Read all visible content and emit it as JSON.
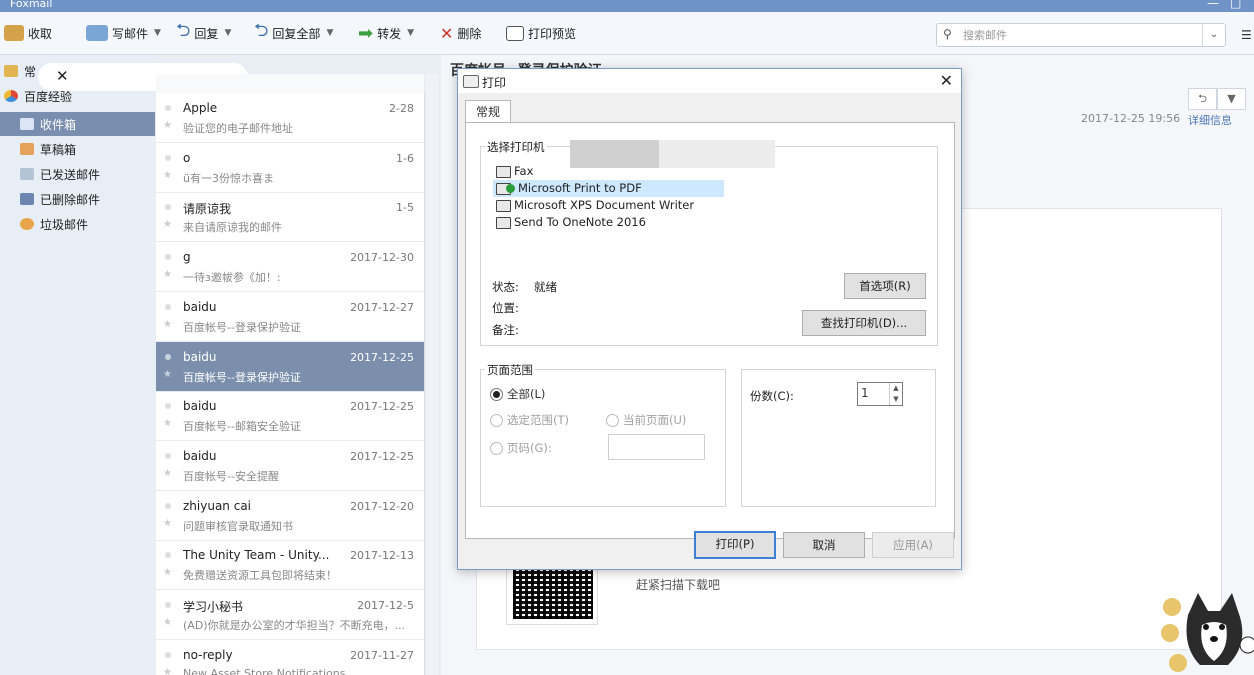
{
  "window": {
    "title": "Foxmail"
  },
  "toolbar": {
    "receive": "收取",
    "write": "写邮件",
    "reply": "回复",
    "reply_all": "回复全部",
    "forward": "转发",
    "delete": "删除",
    "print_preview": "打印预览",
    "search_placeholder": "搜索邮件"
  },
  "sidebar": {
    "account_prefix": "常",
    "account": "百度经验",
    "items": [
      {
        "label": "收件箱"
      },
      {
        "label": "草稿箱"
      },
      {
        "label": "已发送邮件"
      },
      {
        "label": "已删除邮件"
      },
      {
        "label": "垃圾邮件"
      }
    ]
  },
  "mail_list": [
    {
      "from": "Apple",
      "date": "2-28",
      "subject": "验证您的电子邮件地址"
    },
    {
      "from": "o",
      "date": "1-6",
      "subject": "ü有一3份惊ホ喜ま"
    },
    {
      "from": "请原谅我",
      "date": "1-5",
      "subject": "来自请原谅我的邮件"
    },
    {
      "from": "g",
      "date": "2017-12-30",
      "subject": "一待з邀帗参《加！:"
    },
    {
      "from": "baidu",
      "date": "2017-12-27",
      "subject": "百度帐号--登录保护验证"
    },
    {
      "from": "baidu",
      "date": "2017-12-25",
      "subject": "百度帐号--登录保护验证",
      "selected": true
    },
    {
      "from": "baidu",
      "date": "2017-12-25",
      "subject": "百度帐号--邮箱安全验证"
    },
    {
      "from": "baidu",
      "date": "2017-12-25",
      "subject": "百度帐号--安全提醒"
    },
    {
      "from": "zhiyuan cai",
      "date": "2017-12-20",
      "subject": "问题审核官录取通知书"
    },
    {
      "from": "The Unity Team - Unity...",
      "date": "2017-12-13",
      "subject": "免费赠送资源工具包即将结束！"
    },
    {
      "from": "学习小秘书",
      "date": "2017-12-5",
      "subject": "(AD)你就是办公室的才华担当？不断充电，..."
    },
    {
      "from": "no-reply",
      "date": "2017-11-27",
      "subject": "New Asset Store Notifications"
    }
  ],
  "reading": {
    "title": "百度帐号--登录保护验证",
    "date": "2017-12-25 19:56",
    "detail_link": "详细信息",
    "qr_text": "赶紧扫描下载吧"
  },
  "print_dialog": {
    "title": "打印",
    "tab": "常规",
    "select_printer": "选择打印机",
    "printers": [
      {
        "name": "Fax"
      },
      {
        "name": "Microsoft Print to PDF",
        "selected": true
      },
      {
        "name": "Microsoft XPS Document Writer"
      },
      {
        "name": "Send To OneNote 2016"
      }
    ],
    "status_label": "状态:",
    "status_value": "就绪",
    "location_label": "位置:",
    "comment_label": "备注:",
    "preferences_button": "首选项(R)",
    "find_printer_button": "查找打印机(D)...",
    "page_range": "页面范围",
    "all": "全部(L)",
    "selection": "选定范围(T)",
    "current_page": "当前页面(U)",
    "pages": "页码(G):",
    "copies_label": "份数(C):",
    "copies_value": "1",
    "print_button": "打印(P)",
    "cancel_button": "取消",
    "apply_button": "应用(A)"
  }
}
